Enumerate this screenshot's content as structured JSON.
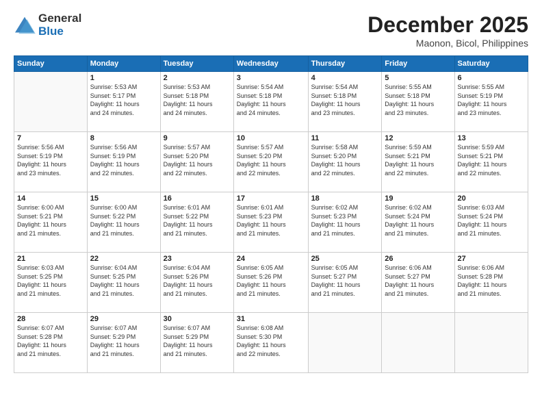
{
  "logo": {
    "line1": "General",
    "line2": "Blue"
  },
  "title": "December 2025",
  "location": "Maonon, Bicol, Philippines",
  "days_of_week": [
    "Sunday",
    "Monday",
    "Tuesday",
    "Wednesday",
    "Thursday",
    "Friday",
    "Saturday"
  ],
  "weeks": [
    [
      {
        "day": "",
        "info": ""
      },
      {
        "day": "1",
        "info": "Sunrise: 5:53 AM\nSunset: 5:17 PM\nDaylight: 11 hours\nand 24 minutes."
      },
      {
        "day": "2",
        "info": "Sunrise: 5:53 AM\nSunset: 5:18 PM\nDaylight: 11 hours\nand 24 minutes."
      },
      {
        "day": "3",
        "info": "Sunrise: 5:54 AM\nSunset: 5:18 PM\nDaylight: 11 hours\nand 24 minutes."
      },
      {
        "day": "4",
        "info": "Sunrise: 5:54 AM\nSunset: 5:18 PM\nDaylight: 11 hours\nand 23 minutes."
      },
      {
        "day": "5",
        "info": "Sunrise: 5:55 AM\nSunset: 5:18 PM\nDaylight: 11 hours\nand 23 minutes."
      },
      {
        "day": "6",
        "info": "Sunrise: 5:55 AM\nSunset: 5:19 PM\nDaylight: 11 hours\nand 23 minutes."
      }
    ],
    [
      {
        "day": "7",
        "info": "Sunrise: 5:56 AM\nSunset: 5:19 PM\nDaylight: 11 hours\nand 23 minutes."
      },
      {
        "day": "8",
        "info": "Sunrise: 5:56 AM\nSunset: 5:19 PM\nDaylight: 11 hours\nand 22 minutes."
      },
      {
        "day": "9",
        "info": "Sunrise: 5:57 AM\nSunset: 5:20 PM\nDaylight: 11 hours\nand 22 minutes."
      },
      {
        "day": "10",
        "info": "Sunrise: 5:57 AM\nSunset: 5:20 PM\nDaylight: 11 hours\nand 22 minutes."
      },
      {
        "day": "11",
        "info": "Sunrise: 5:58 AM\nSunset: 5:20 PM\nDaylight: 11 hours\nand 22 minutes."
      },
      {
        "day": "12",
        "info": "Sunrise: 5:59 AM\nSunset: 5:21 PM\nDaylight: 11 hours\nand 22 minutes."
      },
      {
        "day": "13",
        "info": "Sunrise: 5:59 AM\nSunset: 5:21 PM\nDaylight: 11 hours\nand 22 minutes."
      }
    ],
    [
      {
        "day": "14",
        "info": "Sunrise: 6:00 AM\nSunset: 5:21 PM\nDaylight: 11 hours\nand 21 minutes."
      },
      {
        "day": "15",
        "info": "Sunrise: 6:00 AM\nSunset: 5:22 PM\nDaylight: 11 hours\nand 21 minutes."
      },
      {
        "day": "16",
        "info": "Sunrise: 6:01 AM\nSunset: 5:22 PM\nDaylight: 11 hours\nand 21 minutes."
      },
      {
        "day": "17",
        "info": "Sunrise: 6:01 AM\nSunset: 5:23 PM\nDaylight: 11 hours\nand 21 minutes."
      },
      {
        "day": "18",
        "info": "Sunrise: 6:02 AM\nSunset: 5:23 PM\nDaylight: 11 hours\nand 21 minutes."
      },
      {
        "day": "19",
        "info": "Sunrise: 6:02 AM\nSunset: 5:24 PM\nDaylight: 11 hours\nand 21 minutes."
      },
      {
        "day": "20",
        "info": "Sunrise: 6:03 AM\nSunset: 5:24 PM\nDaylight: 11 hours\nand 21 minutes."
      }
    ],
    [
      {
        "day": "21",
        "info": "Sunrise: 6:03 AM\nSunset: 5:25 PM\nDaylight: 11 hours\nand 21 minutes."
      },
      {
        "day": "22",
        "info": "Sunrise: 6:04 AM\nSunset: 5:25 PM\nDaylight: 11 hours\nand 21 minutes."
      },
      {
        "day": "23",
        "info": "Sunrise: 6:04 AM\nSunset: 5:26 PM\nDaylight: 11 hours\nand 21 minutes."
      },
      {
        "day": "24",
        "info": "Sunrise: 6:05 AM\nSunset: 5:26 PM\nDaylight: 11 hours\nand 21 minutes."
      },
      {
        "day": "25",
        "info": "Sunrise: 6:05 AM\nSunset: 5:27 PM\nDaylight: 11 hours\nand 21 minutes."
      },
      {
        "day": "26",
        "info": "Sunrise: 6:06 AM\nSunset: 5:27 PM\nDaylight: 11 hours\nand 21 minutes."
      },
      {
        "day": "27",
        "info": "Sunrise: 6:06 AM\nSunset: 5:28 PM\nDaylight: 11 hours\nand 21 minutes."
      }
    ],
    [
      {
        "day": "28",
        "info": "Sunrise: 6:07 AM\nSunset: 5:28 PM\nDaylight: 11 hours\nand 21 minutes."
      },
      {
        "day": "29",
        "info": "Sunrise: 6:07 AM\nSunset: 5:29 PM\nDaylight: 11 hours\nand 21 minutes."
      },
      {
        "day": "30",
        "info": "Sunrise: 6:07 AM\nSunset: 5:29 PM\nDaylight: 11 hours\nand 21 minutes."
      },
      {
        "day": "31",
        "info": "Sunrise: 6:08 AM\nSunset: 5:30 PM\nDaylight: 11 hours\nand 22 minutes."
      },
      {
        "day": "",
        "info": ""
      },
      {
        "day": "",
        "info": ""
      },
      {
        "day": "",
        "info": ""
      }
    ]
  ]
}
